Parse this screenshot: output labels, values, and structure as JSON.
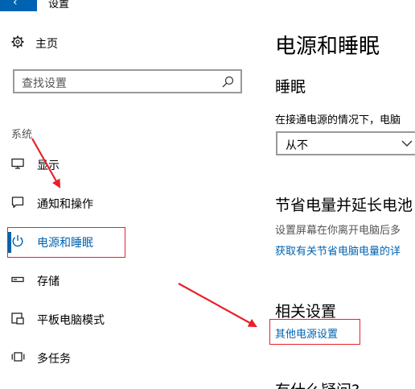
{
  "window": {
    "back_glyph": "‹",
    "title": "设置"
  },
  "home": {
    "label": "主页",
    "icon": "gear-icon"
  },
  "search": {
    "placeholder": "查找设置",
    "icon": "search-icon"
  },
  "sidebar": {
    "section_label": "系统",
    "items": [
      {
        "label": "显示",
        "icon": "monitor-icon"
      },
      {
        "label": "通知和操作",
        "icon": "notification-icon"
      },
      {
        "label": "电源和睡眠",
        "icon": "power-icon",
        "active": true
      },
      {
        "label": "存储",
        "icon": "storage-icon"
      },
      {
        "label": "平板电脑模式",
        "icon": "tablet-mode-icon"
      },
      {
        "label": "多任务",
        "icon": "multitask-icon"
      }
    ]
  },
  "main": {
    "title": "电源和睡眠",
    "sleep": {
      "heading": "睡眠",
      "description": "在接通电源的情况下，电脑",
      "dropdown_value": "从不"
    },
    "save_power": {
      "heading": "节省电量并延长电池",
      "description": "设置屏幕在你离开电脑后多",
      "link": "获取有关节省电脑电量的详"
    },
    "related": {
      "heading": "相关设置",
      "link": "其他电源设置"
    },
    "questions": {
      "heading": "有什么疑问?"
    }
  },
  "colors": {
    "accent": "#0063b1",
    "annotation": "#e8212a"
  }
}
